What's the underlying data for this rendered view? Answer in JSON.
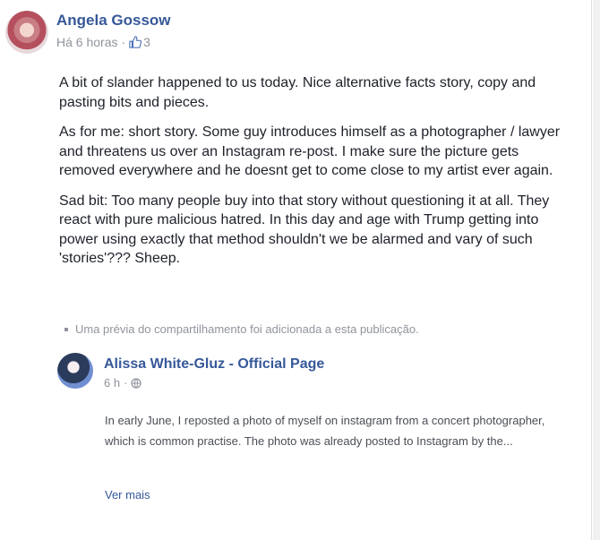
{
  "post": {
    "author": "Angela Gossow",
    "time": "Há 6 horas",
    "separator": "·",
    "reaction_count": "3",
    "paragraphs": [
      "A bit of slander happened to us today. Nice alternative facts story, copy and pasting bits and pieces.",
      "As for me: short story. Some guy introduces himself as a photographer / lawyer and threatens us over an Instagram re-post. I make sure the picture gets removed everywhere and he doesnt get to come close to my artist ever again.",
      "Sad bit: Too many people buy into that story without questioning it at all. They react with pure malicious hatred. In this day and age with Trump getting into power using exactly that method shouldn't we be alarmed and vary of such 'stories'??? Sheep."
    ],
    "share_note": "Uma prévia do compartilhamento foi adicionada a esta publicação."
  },
  "shared": {
    "author": "Alissa White-Gluz - Official Page",
    "time": "6 h",
    "separator": "·",
    "text": "In early June, I reposted a photo of myself on instagram from a concert photographer, which is common practise. The photo was already posted to Instagram by the...",
    "see_more": "Ver mais"
  },
  "icons": {
    "reaction": "thumbs-up-icon",
    "privacy": "globe-icon"
  },
  "colors": {
    "link": "#365899",
    "text": "#1d2129",
    "meta": "#90949c"
  }
}
